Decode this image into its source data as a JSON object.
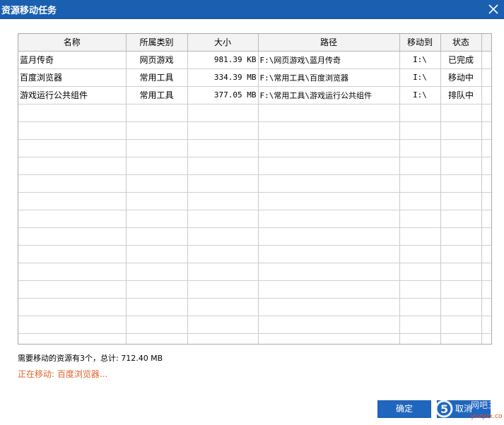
{
  "window": {
    "title": "资源移动任务"
  },
  "table": {
    "headers": [
      "名称",
      "所属类别",
      "大小",
      "路径",
      "移动到",
      "状态"
    ],
    "rows": [
      {
        "name": "蓝月传奇",
        "category": "网页游戏",
        "size": "981.39 KB",
        "path": "F:\\网页游戏\\蓝月传奇",
        "dest": "I:\\",
        "status": "已完成"
      },
      {
        "name": "百度浏览器",
        "category": "常用工具",
        "size": "334.39 MB",
        "path": "F:\\常用工具\\百度浏览器",
        "dest": "I:\\",
        "status": "移动中"
      },
      {
        "name": "游戏运行公共组件",
        "category": "常用工具",
        "size": "377.05 MB",
        "path": "F:\\常用工具\\游戏运行公共组件",
        "dest": "I:\\",
        "status": "排队中"
      }
    ]
  },
  "summary": "需要移动的资源有3个，总计: 712.40 MB",
  "moving": "正在移动: 百度浏览器...",
  "buttons": {
    "ok": "确定",
    "cancel": "取消"
  },
  "watermark": {
    "text": "网吧三",
    "sub": "yuzyzx.com"
  },
  "colors": {
    "titlebar": "#1b5fb0",
    "button": "#1f66bf",
    "moving_text": "#e0642c"
  }
}
